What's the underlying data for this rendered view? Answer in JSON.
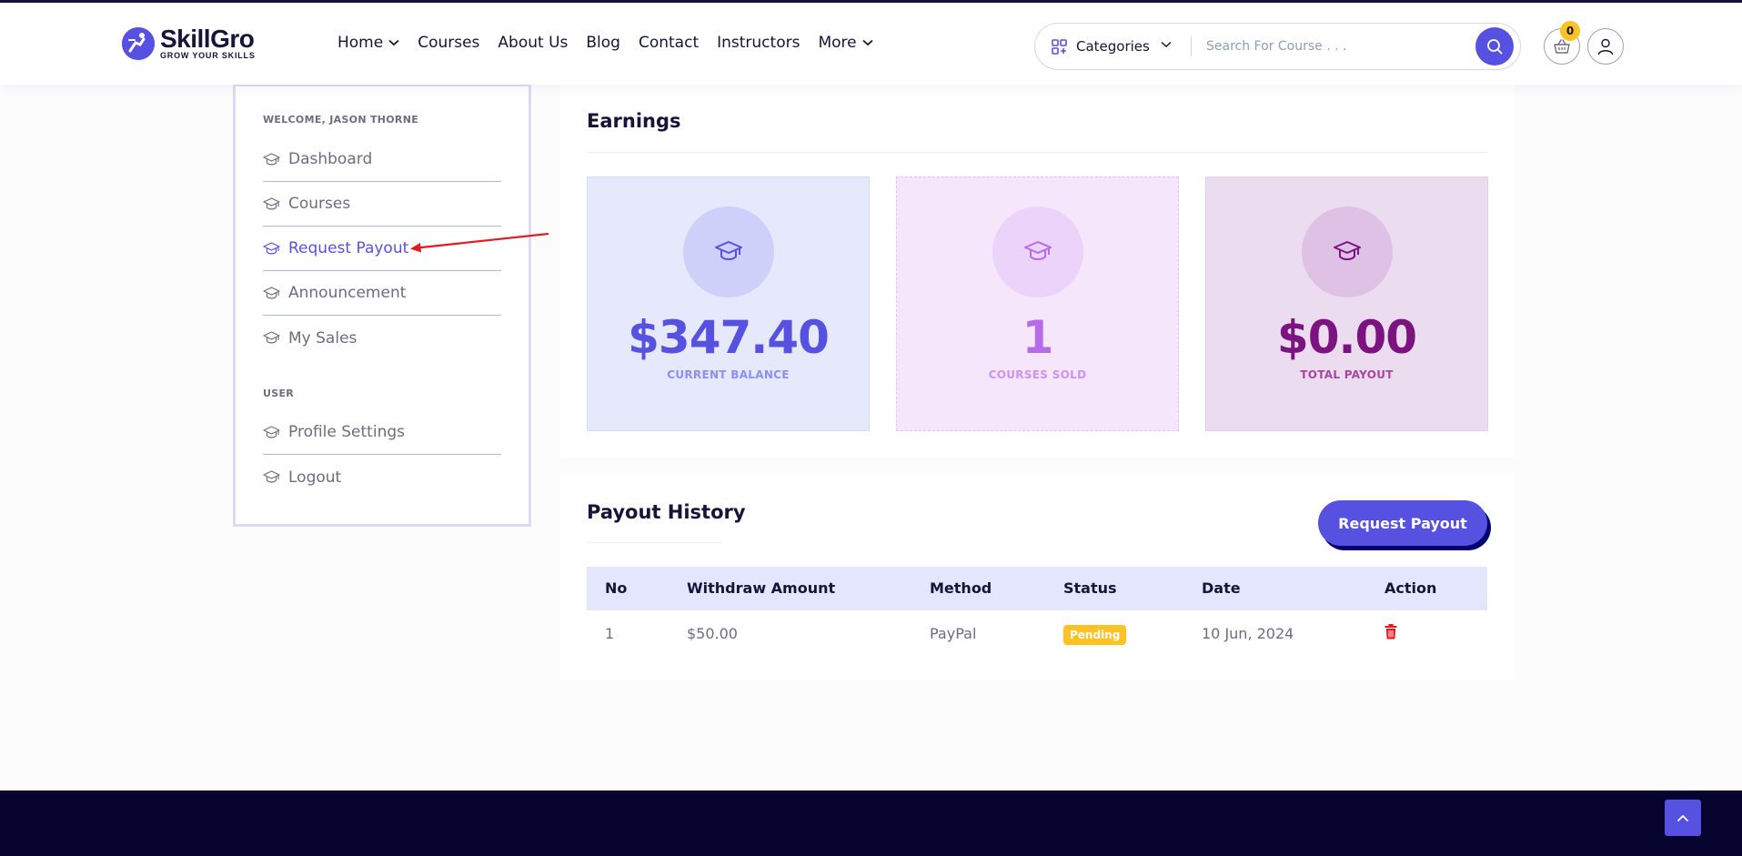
{
  "brand": {
    "name": "SkillGro",
    "tagline": "GROW YOUR SKILLS",
    "accent": "#5751e1",
    "dark": "#161439"
  },
  "nav": {
    "items": [
      {
        "label": "Home",
        "has_dropdown": true
      },
      {
        "label": "Courses",
        "has_dropdown": false
      },
      {
        "label": "About Us",
        "has_dropdown": false
      },
      {
        "label": "Blog",
        "has_dropdown": false
      },
      {
        "label": "Contact",
        "has_dropdown": false
      },
      {
        "label": "Instructors",
        "has_dropdown": false
      },
      {
        "label": "More",
        "has_dropdown": true
      }
    ]
  },
  "search": {
    "category_label": "Categories",
    "placeholder": "Search For Course . . .",
    "value": ""
  },
  "cart": {
    "count": "0"
  },
  "sidebar": {
    "welcome": "WELCOME, JASON THORNE",
    "items": [
      {
        "label": "Dashboard",
        "icon": "graduation-cap-icon",
        "active": false
      },
      {
        "label": "Courses",
        "icon": "graduation-cap-icon",
        "active": false
      },
      {
        "label": "Request Payout",
        "icon": "graduation-cap-icon",
        "active": true
      },
      {
        "label": "Announcement",
        "icon": "graduation-cap-icon",
        "active": false
      },
      {
        "label": "My Sales",
        "icon": "graduation-cap-icon",
        "active": false
      }
    ],
    "user_heading": "USER",
    "user_items": [
      {
        "label": "Profile Settings",
        "icon": "graduation-cap-icon"
      },
      {
        "label": "Logout",
        "icon": "graduation-cap-icon"
      }
    ]
  },
  "earnings": {
    "title": "Earnings",
    "cards": [
      {
        "value": "$347.40",
        "label": "CURRENT BALANCE",
        "color": "#5751e1"
      },
      {
        "value": "1",
        "label": "COURSES SOLD",
        "color": "#b66ce8"
      },
      {
        "value": "$0.00",
        "label": "TOTAL PAYOUT",
        "color": "#7b1380"
      }
    ]
  },
  "payout_history": {
    "title": "Payout History",
    "request_button": "Request Payout",
    "columns": [
      "No",
      "Withdraw Amount",
      "Method",
      "Status",
      "Date",
      "Action"
    ],
    "rows": [
      {
        "no": "1",
        "amount": "$50.00",
        "method": "PayPal",
        "status": "Pending",
        "date": "10 Jun, 2024",
        "action_icon": "trash-icon"
      }
    ]
  },
  "colors": {
    "status_pending": "#ffc224",
    "delete": "#e21b23",
    "annotation_arrow": "#e21b23",
    "footer_bg": "#06042e"
  }
}
